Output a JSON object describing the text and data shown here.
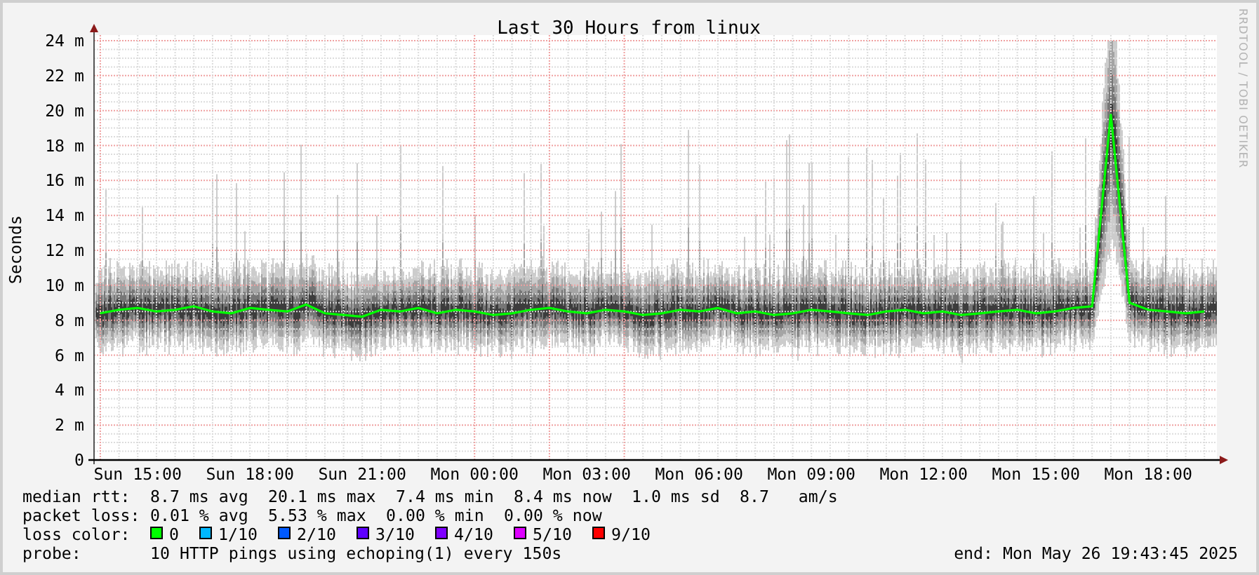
{
  "graph": {
    "chart_data": {
      "type": "line",
      "title": "Last 30 Hours from linux",
      "ylabel": "Seconds",
      "grid": true,
      "ylim": [
        0,
        24
      ],
      "yticks": [
        {
          "value": 0,
          "label": "0"
        },
        {
          "value": 2,
          "label": "2 m"
        },
        {
          "value": 4,
          "label": "4 m"
        },
        {
          "value": 6,
          "label": "6 m"
        },
        {
          "value": 8,
          "label": "8 m"
        },
        {
          "value": 10,
          "label": "10 m"
        },
        {
          "value": 12,
          "label": "12 m"
        },
        {
          "value": 14,
          "label": "14 m"
        },
        {
          "value": 16,
          "label": "16 m"
        },
        {
          "value": 18,
          "label": "18 m"
        },
        {
          "value": 20,
          "label": "20 m"
        },
        {
          "value": 22,
          "label": "22 m"
        },
        {
          "value": 24,
          "label": "24 m"
        }
      ],
      "categories": [
        null,
        null,
        "Sun 15:00",
        null,
        null,
        null,
        null,
        null,
        "Sun 18:00",
        null,
        null,
        null,
        null,
        null,
        "Sun 21:00",
        null,
        null,
        null,
        null,
        null,
        "Mon 00:00",
        null,
        null,
        null,
        null,
        null,
        "Mon 03:00",
        null,
        null,
        null,
        null,
        null,
        "Mon 06:00",
        null,
        null,
        null,
        null,
        null,
        "Mon 09:00",
        null,
        null,
        null,
        null,
        null,
        "Mon 12:00",
        null,
        null,
        null,
        null,
        null,
        "Mon 15:00",
        null,
        null,
        null,
        null,
        null,
        "Mon 18:00",
        null,
        null,
        null
      ],
      "series": [
        {
          "color": "#00ff00",
          "values": [
            8.4,
            8.6,
            8.7,
            8.5,
            8.6,
            8.8,
            8.5,
            8.4,
            8.7,
            8.6,
            8.5,
            8.9,
            8.4,
            8.3,
            8.2,
            8.6,
            8.5,
            8.7,
            8.4,
            8.6,
            8.5,
            8.3,
            8.4,
            8.6,
            8.7,
            8.5,
            8.4,
            8.6,
            8.5,
            8.3,
            8.4,
            8.6,
            8.5,
            8.7,
            8.4,
            8.5,
            8.3,
            8.4,
            8.6,
            8.5,
            8.4,
            8.3,
            8.5,
            8.6,
            8.4,
            8.5,
            8.3,
            8.4,
            8.5,
            8.6,
            8.4,
            8.5,
            8.7,
            8.8,
            19.8,
            9.0,
            8.6,
            8.5,
            8.4,
            8.5
          ]
        }
      ]
    }
  },
  "credit": "RRDTOOL / TOBI OETIKER",
  "legend": {
    "stats": [
      {
        "label": "median rtt:",
        "items": [
          "8.7 ms avg",
          "20.1 ms max",
          "7.4 ms min",
          "8.4 ms now",
          "1.0 ms sd",
          "8.7   am/s"
        ]
      },
      {
        "label": "packet loss:",
        "items": [
          "0.01 % avg",
          "5.53 % max",
          "0.00 % min",
          "0.00 % now"
        ]
      }
    ],
    "loss_label": "loss color:",
    "loss_colors": [
      {
        "label": "0",
        "color": "#00ff00"
      },
      {
        "label": "1/10",
        "color": "#00b8ff"
      },
      {
        "label": "2/10",
        "color": "#0059ff"
      },
      {
        "label": "3/10",
        "color": "#5e00ff"
      },
      {
        "label": "4/10",
        "color": "#7e00ff"
      },
      {
        "label": "5/10",
        "color": "#dd00ff"
      },
      {
        "label": "9/10",
        "color": "#ff0000"
      }
    ],
    "probe_label": "probe:",
    "probe": "10 HTTP pings using echoping(1) every 150s",
    "end": "end: Mon May 26 19:43:45 2025"
  }
}
